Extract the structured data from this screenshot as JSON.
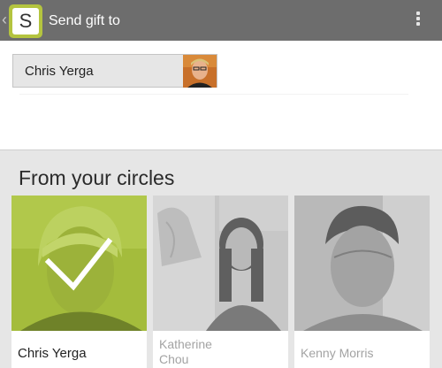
{
  "action_bar": {
    "back_glyph": "‹",
    "app_icon_letter": "S",
    "title": "Send gift to",
    "overflow_icon": "overflow-menu-icon"
  },
  "recipient": {
    "name": "Chris Yerga"
  },
  "circles": {
    "heading": "From your circles",
    "people": [
      {
        "name": "Chris Yerga",
        "selected": true
      },
      {
        "name": "Katherine Chou",
        "name_line1": "Katherine",
        "name_line2": "Chou",
        "selected": false
      },
      {
        "name": "Kenny Morris",
        "selected": false
      }
    ]
  },
  "colors": {
    "action_bar": "#6d6d6d",
    "accent_green": "#b4c43f",
    "selected_tint": "#a4bc3c"
  }
}
